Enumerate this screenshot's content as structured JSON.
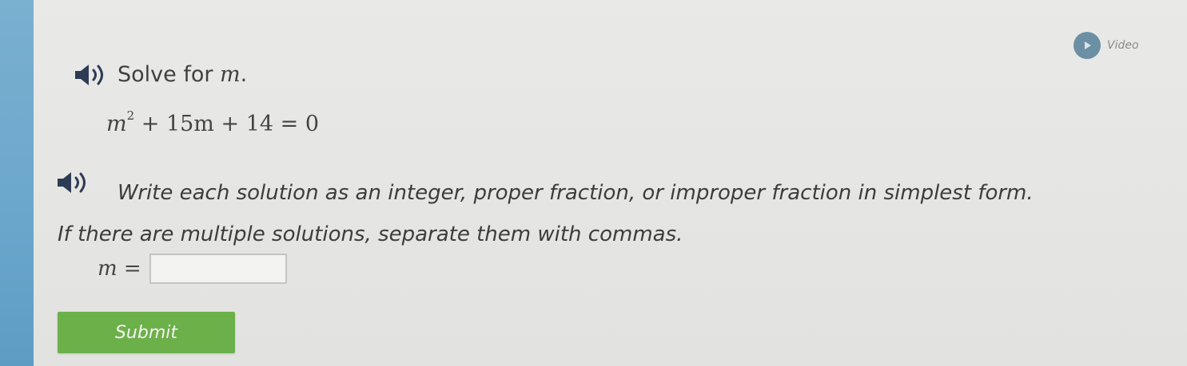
{
  "video": {
    "label": "Video",
    "icon": "play-icon"
  },
  "question": {
    "prompt": "Solve for ",
    "variable": "m",
    "prompt_end": ".",
    "equation": {
      "base": "m",
      "exponent": "2",
      "rest": " + 15m + 14 = 0"
    },
    "instructions_line1": "Write each solution as an integer, proper fraction, or improper fraction in simplest form.",
    "instructions_line2": "If there are multiple solutions, separate them with commas."
  },
  "answer": {
    "label": "m =",
    "value": "",
    "placeholder": ""
  },
  "submit": {
    "label": "Submit"
  },
  "colors": {
    "accent_blue": "#6aa6cc",
    "submit_green": "#6cb04a",
    "video_icon": "#6b8fa5"
  },
  "icons": {
    "speaker": "speaker-icon"
  }
}
